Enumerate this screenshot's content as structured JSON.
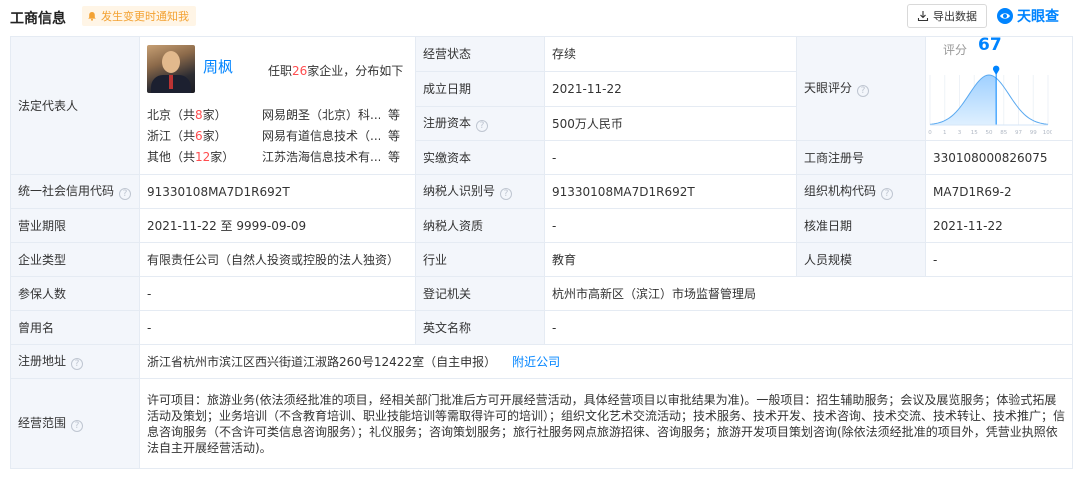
{
  "header": {
    "title": "工商信息",
    "notify_label": "发生变更时通知我",
    "export_label": "导出数据",
    "logo_text": "天眼查"
  },
  "legal_rep": {
    "label": "法定代表人",
    "name": "周枫",
    "count_prefix": "任职",
    "count": "26",
    "count_suffix": "家企业，分布如下",
    "regions": [
      {
        "prefix": "北京（共",
        "count": "8",
        "suffix": "家）",
        "company": "网易朗圣（北京）科...",
        "more": "等"
      },
      {
        "prefix": "浙江（共",
        "count": "6",
        "suffix": "家）",
        "company": "网易有道信息技术（...",
        "more": "等"
      },
      {
        "prefix": "其他（共",
        "count": "12",
        "suffix": "家）",
        "company": "江苏浩海信息技术有...",
        "more": "等"
      }
    ]
  },
  "fields": {
    "biz_status": {
      "label": "经营状态",
      "value": "存续"
    },
    "established": {
      "label": "成立日期",
      "value": "2021-11-22"
    },
    "reg_capital": {
      "label": "注册资本",
      "value": "500万人民币"
    },
    "paid_capital": {
      "label": "实缴资本",
      "value": "-"
    },
    "tianyan_score": {
      "label": "天眼评分",
      "score_label": "评分",
      "score": 67,
      "axis": [
        "0",
        "1",
        "3",
        "15",
        "50",
        "85",
        "97",
        "99",
        "100"
      ]
    },
    "reg_number": {
      "label": "工商注册号",
      "value": "330108000826075"
    },
    "credit_code": {
      "label": "统一社会信用代码",
      "value": "91330108MA7D1R692T"
    },
    "taxpayer_id": {
      "label": "纳税人识别号",
      "value": "91330108MA7D1R692T"
    },
    "org_code": {
      "label": "组织机构代码",
      "value": "MA7D1R69-2"
    },
    "biz_term": {
      "label": "营业期限",
      "value": "2021-11-22 至 9999-09-09"
    },
    "taxpayer_qual": {
      "label": "纳税人资质",
      "value": "-"
    },
    "approval_date": {
      "label": "核准日期",
      "value": "2021-11-22"
    },
    "company_type": {
      "label": "企业类型",
      "value": "有限责任公司（自然人投资或控股的法人独资）"
    },
    "industry": {
      "label": "行业",
      "value": "教育"
    },
    "staff_size": {
      "label": "人员规模",
      "value": "-"
    },
    "insured": {
      "label": "参保人数",
      "value": "-"
    },
    "authority": {
      "label": "登记机关",
      "value": "杭州市高新区（滨江）市场监督管理局"
    },
    "former_name": {
      "label": "曾用名",
      "value": "-"
    },
    "english_name": {
      "label": "英文名称",
      "value": "-"
    },
    "address": {
      "label": "注册地址",
      "value": "浙江省杭州市滨江区西兴街道江淑路260号12422室（自主申报）",
      "link": "附近公司"
    },
    "scope": {
      "label": "经营范围",
      "value": "许可项目：旅游业务(依法须经批准的项目，经相关部门批准后方可开展经营活动，具体经营项目以审批结果为准)。一般项目：招生辅助服务；会议及展览服务；体验式拓展活动及策划；业务培训（不含教育培训、职业技能培训等需取得许可的培训）；组织文化艺术交流活动；技术服务、技术开发、技术咨询、技术交流、技术转让、技术推广；信息咨询服务（不含许可类信息咨询服务）；礼仪服务；咨询策划服务；旅行社服务网点旅游招徕、咨询服务；旅游开发项目策划咨询(除依法须经批准的项目外，凭营业执照依法自主开展经营活动)。"
    }
  },
  "colors": {
    "accent": "#0084ff",
    "label_bg": "#f3f6fb",
    "border": "#e5ebf3",
    "highlight": "#ff4d4f",
    "notify": "#f3a233"
  }
}
